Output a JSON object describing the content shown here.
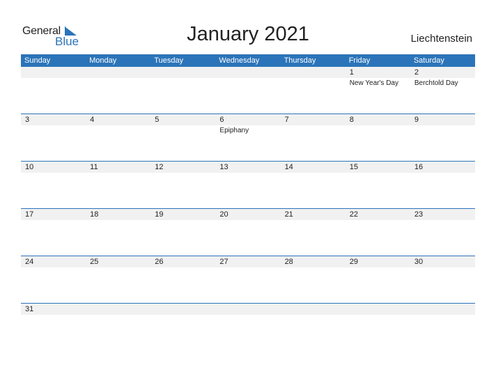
{
  "logo": {
    "general": "General",
    "blue": "Blue"
  },
  "title": "January 2021",
  "country": "Liechtenstein",
  "colors": {
    "accent": "#2b74b9",
    "strip": "#f1f1f1"
  },
  "weekdays": [
    "Sunday",
    "Monday",
    "Tuesday",
    "Wednesday",
    "Thursday",
    "Friday",
    "Saturday"
  ],
  "weeks": [
    [
      {
        "d": ""
      },
      {
        "d": ""
      },
      {
        "d": ""
      },
      {
        "d": ""
      },
      {
        "d": ""
      },
      {
        "d": "1",
        "h": "New Year's Day"
      },
      {
        "d": "2",
        "h": "Berchtold Day"
      }
    ],
    [
      {
        "d": "3"
      },
      {
        "d": "4"
      },
      {
        "d": "5"
      },
      {
        "d": "6",
        "h": "Epiphany"
      },
      {
        "d": "7"
      },
      {
        "d": "8"
      },
      {
        "d": "9"
      }
    ],
    [
      {
        "d": "10"
      },
      {
        "d": "11"
      },
      {
        "d": "12"
      },
      {
        "d": "13"
      },
      {
        "d": "14"
      },
      {
        "d": "15"
      },
      {
        "d": "16"
      }
    ],
    [
      {
        "d": "17"
      },
      {
        "d": "18"
      },
      {
        "d": "19"
      },
      {
        "d": "20"
      },
      {
        "d": "21"
      },
      {
        "d": "22"
      },
      {
        "d": "23"
      }
    ],
    [
      {
        "d": "24"
      },
      {
        "d": "25"
      },
      {
        "d": "26"
      },
      {
        "d": "27"
      },
      {
        "d": "28"
      },
      {
        "d": "29"
      },
      {
        "d": "30"
      }
    ],
    [
      {
        "d": "31"
      },
      {
        "d": ""
      },
      {
        "d": ""
      },
      {
        "d": ""
      },
      {
        "d": ""
      },
      {
        "d": ""
      },
      {
        "d": ""
      }
    ]
  ]
}
